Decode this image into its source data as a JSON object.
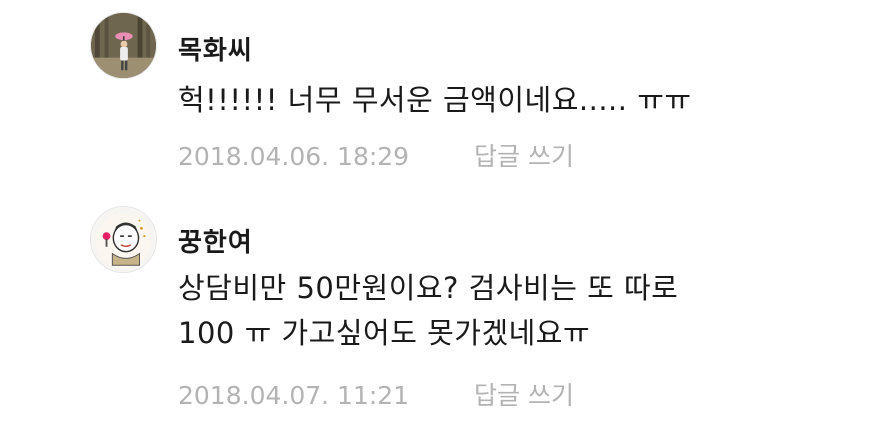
{
  "comments": [
    {
      "username": "목화씨",
      "text_lines": [
        "헉!!!!!! 너무 무서운 금액이네요..... ㅠㅠ"
      ],
      "timestamp": "2018.04.06. 18:29",
      "reply_label": "답글 쓰기",
      "avatar_icon": "profile-photo-woman-with-pink-umbrella-in-forest"
    },
    {
      "username": "꿍한여",
      "text_lines": [
        "상담비만 50만원이요? 검사비는 또 따로",
        "100 ㅠ 가고싶어도 못가겠네요ㅠ"
      ],
      "timestamp": "2018.04.07. 11:21",
      "reply_label": "답글 쓰기",
      "avatar_icon": "cartoon-character-avatar"
    }
  ]
}
